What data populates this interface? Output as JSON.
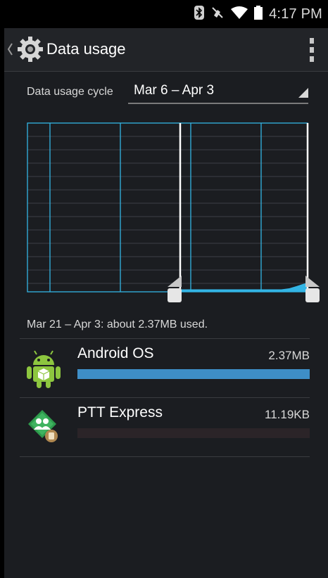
{
  "status_bar": {
    "time": "4:17 PM",
    "icons": [
      "bluetooth-icon",
      "mute-icon",
      "wifi-icon",
      "battery-icon"
    ]
  },
  "action_bar": {
    "title": "Data usage",
    "app_icon": "gear-icon",
    "overflow_icon": "overflow-menu-icon"
  },
  "cycle": {
    "label": "Data usage cycle",
    "value": "Mar 6 – Apr 3"
  },
  "usage_summary": "Mar 21 – Apr 3: about 2.37MB used.",
  "apps": [
    {
      "name": "Android OS",
      "size": "2.37MB",
      "fraction": 1.0,
      "icon": "android-os-icon"
    },
    {
      "name": "PTT Express",
      "size": "11.19KB",
      "fraction": 0.0,
      "icon": "ptt-express-icon"
    }
  ],
  "colors": {
    "accent": "#3e8ec7",
    "chart_line": "#33b5e5",
    "background": "#1b1d21"
  }
}
